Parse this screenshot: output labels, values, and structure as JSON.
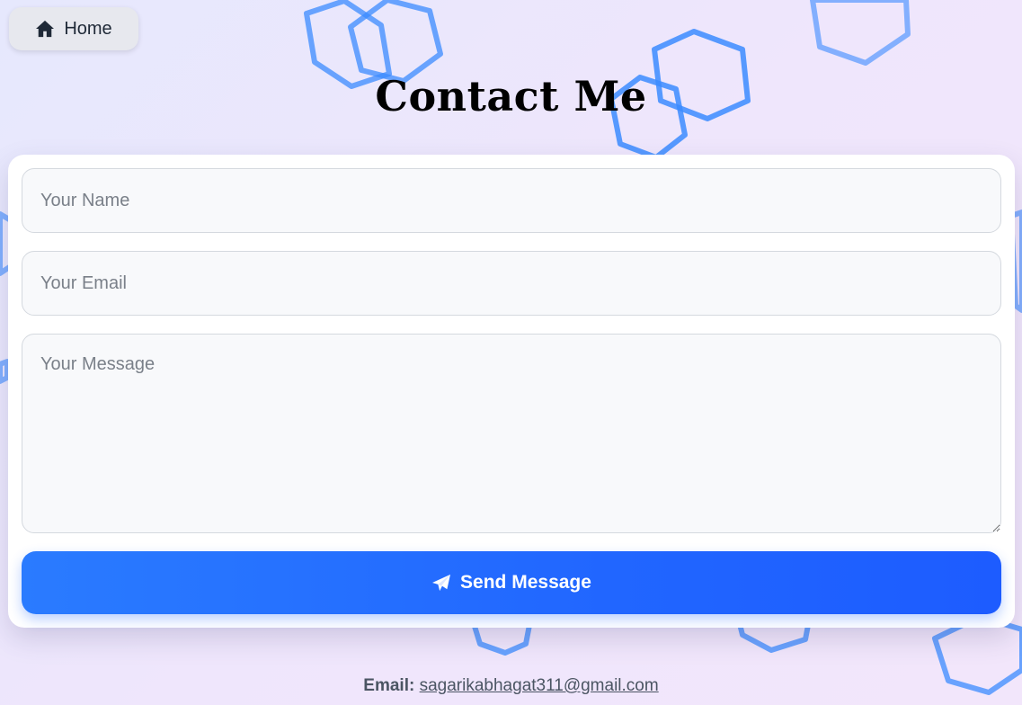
{
  "nav": {
    "home_label": "Home",
    "home_icon": "home-icon"
  },
  "page": {
    "title": "Contact Me"
  },
  "form": {
    "name_placeholder": "Your Name",
    "email_placeholder": "Your Email",
    "message_placeholder": "Your Message",
    "name_value": "",
    "email_value": "",
    "message_value": "",
    "send_label": "Send Message",
    "send_icon": "paper-plane-icon"
  },
  "footer": {
    "email_label": "Email:",
    "email_address": "sagarikabhagat311@gmail.com"
  },
  "colors": {
    "accent": "#2166ff",
    "hexagon": "#3b8bff",
    "background": "#ece6fc"
  }
}
